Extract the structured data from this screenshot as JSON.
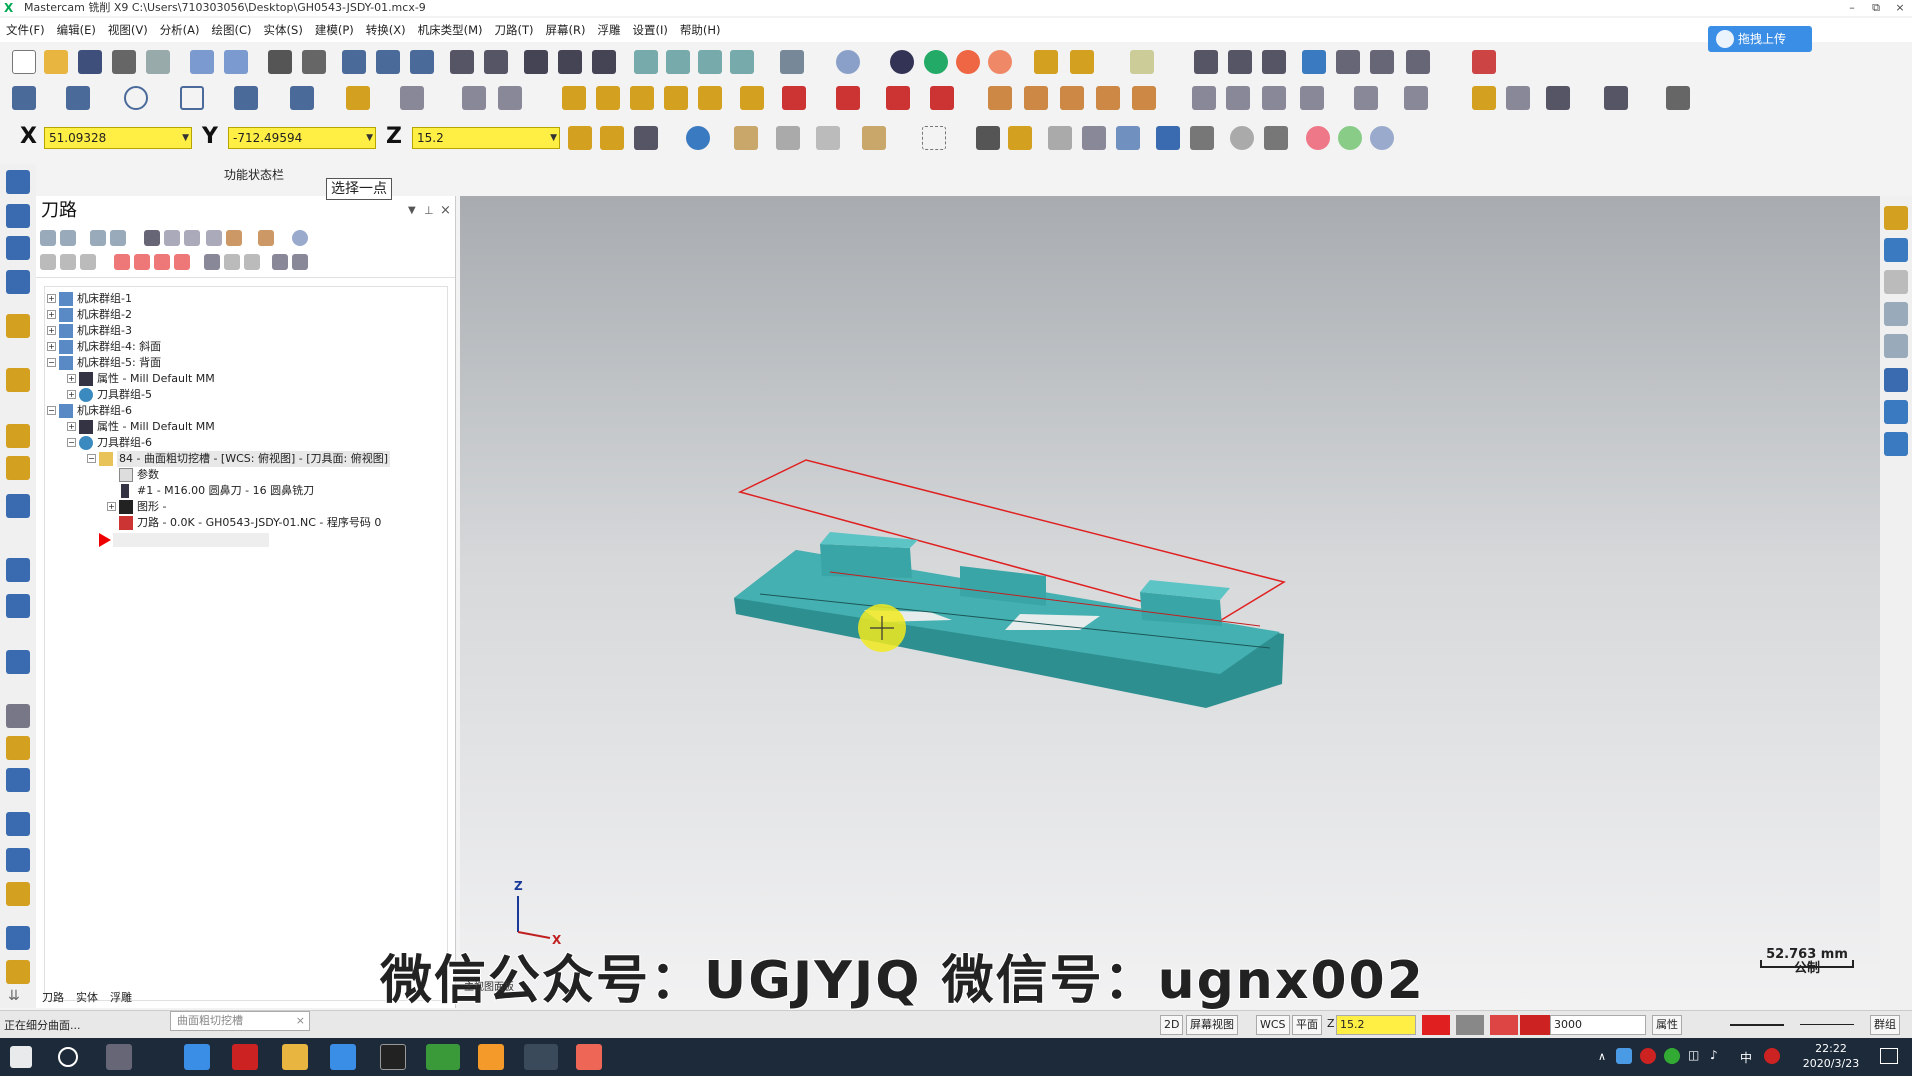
{
  "window": {
    "title": "Mastercam 铣削 X9  C:\\Users\\710303056\\Desktop\\GH0543-JSDY-01.mcx-9",
    "minimize": "–",
    "restore": "⧉",
    "close": "×"
  },
  "menu": [
    "文件(F)",
    "编辑(E)",
    "视图(V)",
    "分析(A)",
    "绘图(C)",
    "实体(S)",
    "建模(P)",
    "转换(X)",
    "机床类型(M)",
    "刀路(T)",
    "屏幕(R)",
    "浮雕",
    "设置(I)",
    "帮助(H)"
  ],
  "upload_button": "拖拽上传",
  "coords": {
    "x_label": "X",
    "x_value": "51.09328",
    "y_label": "Y",
    "y_value": "-712.49594",
    "z_label": "Z",
    "z_value": "15.2"
  },
  "function_status_label": "功能状态栏",
  "prompt_tooltip": "选择一点",
  "panel": {
    "title": "刀路",
    "tree": [
      {
        "text": "机床群组-1",
        "expander": "+"
      },
      {
        "text": "机床群组-2",
        "expander": "+"
      },
      {
        "text": "机床群组-3",
        "expander": "+"
      },
      {
        "text": "机床群组-4: 斜面",
        "expander": "+"
      },
      {
        "text": "机床群组-5: 背面",
        "expander": "−"
      },
      {
        "text": "属性 - Mill Default MM",
        "expander": "+"
      },
      {
        "text": "刀具群组-5",
        "expander": "+"
      },
      {
        "text": "机床群组-6",
        "expander": "−"
      },
      {
        "text": "属性 - Mill Default MM",
        "expander": "+"
      },
      {
        "text": "刀具群组-6",
        "expander": "−"
      },
      {
        "text": "84 - 曲面粗切挖槽 - [WCS: 俯视图] - [刀具面: 俯视图]",
        "expander": "−"
      },
      {
        "text": "参数",
        "expander": ""
      },
      {
        "text": "#1 - M16.00 圆鼻刀 - 16 圆鼻铣刀",
        "expander": ""
      },
      {
        "text": "图形 -",
        "expander": "+"
      },
      {
        "text": "刀路 - 0.0K - GH0543-JSDY-01.NC - 程序号码 0",
        "expander": ""
      }
    ]
  },
  "bottom_tabs": [
    "刀路",
    "实体",
    "浮雕"
  ],
  "view_label": "主视图面板",
  "scale": {
    "value": "52.763 mm",
    "unit": "公制"
  },
  "axis": {
    "z": "Z",
    "x": "X"
  },
  "watermark": "微信公众号：UGJYJQ    微信号：ugnx002",
  "status": {
    "left_text": "正在细分曲面...",
    "task_chip": "曲面粗切挖槽",
    "mode_2d": "2D",
    "screen_view": "屏幕视图",
    "wcs": "WCS",
    "plane": "平面",
    "z_label": "Z",
    "z_value": "15.2",
    "level": "3000",
    "attr": "属性",
    "group": "群组"
  },
  "taskbar": {
    "time": "22:22",
    "date": "2020/3/23",
    "ime": "中"
  },
  "colors": {
    "accent": "#3a8ee6",
    "coord_field": "#ffee44",
    "model": "#3fa7a8",
    "boundary": "#e02020"
  }
}
